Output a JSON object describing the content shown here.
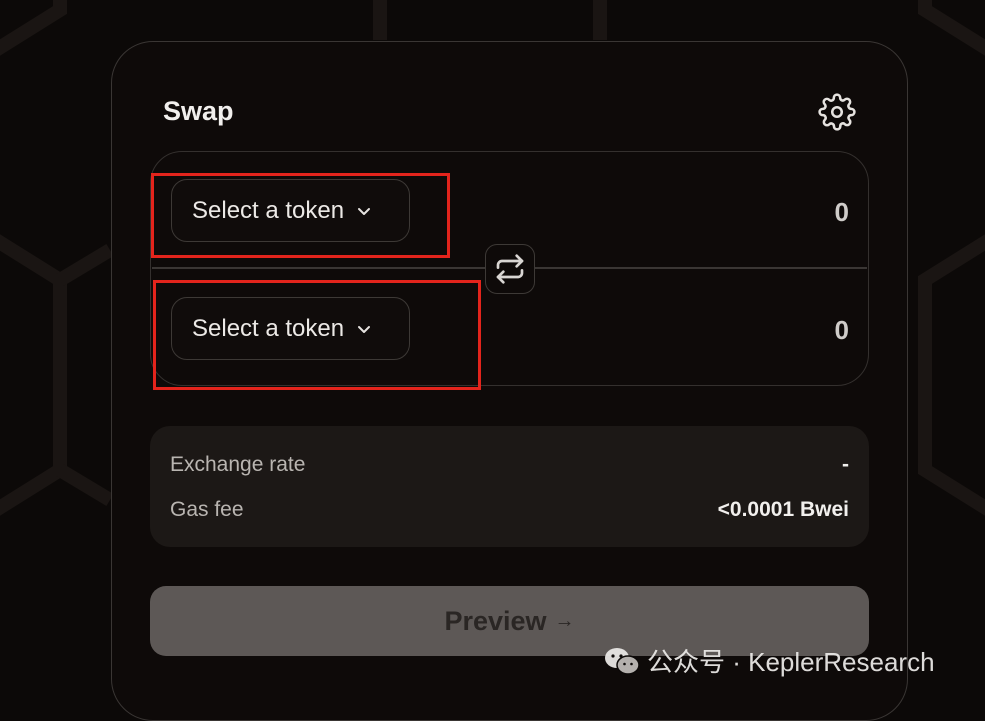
{
  "swap": {
    "title": "Swap",
    "settings_icon": "gear-icon",
    "from": {
      "select_label": "Select a token",
      "amount": "0",
      "chevron_icon": "chevron-down-icon"
    },
    "to": {
      "select_label": "Select a token",
      "amount": "0",
      "chevron_icon": "chevron-down-icon"
    },
    "switch_icon": "swap-arrows-icon",
    "info": {
      "exchange_rate_label": "Exchange rate",
      "exchange_rate_value": "-",
      "gas_fee_label": "Gas fee",
      "gas_fee_value": "<0.0001 Bwei"
    },
    "preview": {
      "label": "Preview",
      "arrow": "→"
    }
  },
  "watermark": {
    "text": "公众号 · KeplerResearch",
    "icon": "wechat-icon"
  },
  "colors": {
    "background": "#0c0908",
    "card_border": "#3a3634",
    "info_bg": "#1c1816",
    "preview_bg": "#5d5856",
    "highlight": "#e3241c"
  }
}
